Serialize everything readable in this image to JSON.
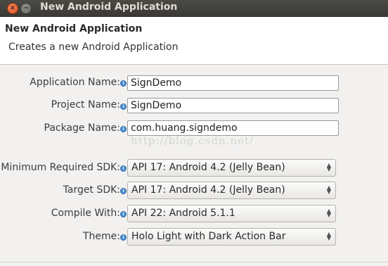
{
  "window": {
    "title": "New Android Application",
    "close_glyph": "×",
    "minimize_glyph": "−"
  },
  "header": {
    "title": "New Android Application",
    "subtitle": "Creates a new Android Application"
  },
  "fields": {
    "application_name": {
      "label": "Application Name:",
      "value": "SignDemo"
    },
    "project_name": {
      "label": "Project Name:",
      "value": "SignDemo"
    },
    "package_name": {
      "label": "Package Name:",
      "value": "com.huang.signdemo"
    }
  },
  "sdk": {
    "min_sdk": {
      "label": "Minimum Required SDK:",
      "value": "API 17: Android 4.2 (Jelly Bean)"
    },
    "target_sdk": {
      "label": "Target SDK:",
      "value": "API 17: Android 4.2 (Jelly Bean)"
    },
    "compile_with": {
      "label": "Compile With:",
      "value": "API 22: Android 5.1.1"
    },
    "theme": {
      "label": "Theme:",
      "value": "Holo Light with Dark Action Bar"
    }
  },
  "info_glyph": "i",
  "watermark": "http://blog.csdn.net/",
  "colors": {
    "info": "#4b8fd6",
    "close": "#e2521f",
    "titlebar": "#3b3a36"
  }
}
